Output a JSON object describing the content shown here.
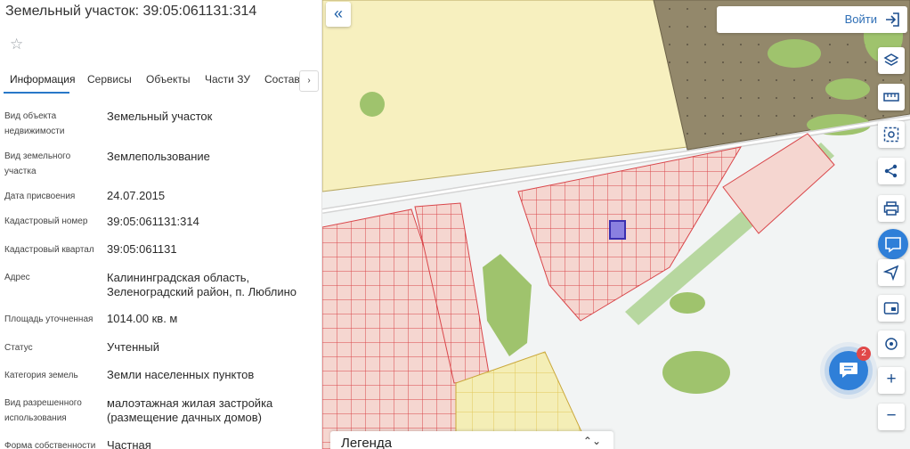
{
  "panel": {
    "title": "Земельный участок: 39:05:061131:314",
    "tabs": [
      "Информация",
      "Сервисы",
      "Объекты",
      "Части ЗУ",
      "Состав"
    ],
    "tab_scroll_glyph": "›",
    "rows": [
      {
        "label": "Вид объекта недвижимости",
        "value": "Земельный участок"
      },
      {
        "label": "Вид земельного участка",
        "value": "Землепользование"
      },
      {
        "label": "Дата присвоения",
        "value": "24.07.2015"
      },
      {
        "label": "Кадастровый номер",
        "value": "39:05:061131:314"
      },
      {
        "label": "Кадастровый квартал",
        "value": "39:05:061131"
      },
      {
        "label": "Адрес",
        "value": "Калининградская область, Зеленоградский район, п. Люблино"
      },
      {
        "label": "Площадь уточненная",
        "value": "1014.00 кв. м"
      },
      {
        "label": "Статус",
        "value": "Учтенный"
      },
      {
        "label": "Категория земель",
        "value": "Земли населенных пунктов"
      },
      {
        "label": "Вид разрешенного использования",
        "value": "малоэтажная жилая застройка (размещение дачных домов)"
      },
      {
        "label": "Форма собственности",
        "value": "Частная"
      }
    ]
  },
  "map": {
    "collapse_glyph": "«",
    "login_label": "Войти",
    "tools": [
      "layers-icon",
      "ruler-icon",
      "area-select-icon",
      "share-icon",
      "print-icon",
      "basemap-icon",
      "navigation-icon",
      "window-icon",
      "location-icon",
      "zoom-in",
      "zoom-out"
    ],
    "zoom_in_glyph": "+",
    "zoom_out_glyph": "−",
    "chat_badge": "2",
    "legend_label": "Легенда",
    "legend_toggle_glyph": "⌃⌄"
  },
  "colors": {
    "accent": "#2878c8",
    "parcel_fill": "#f5d6d0",
    "parcel_line": "#d9464a",
    "zone_yellow": "#f7f0bf",
    "forest_dark": "#93886b",
    "green_area": "#b5d48a",
    "selected_parcel": "#6b5fd0"
  }
}
